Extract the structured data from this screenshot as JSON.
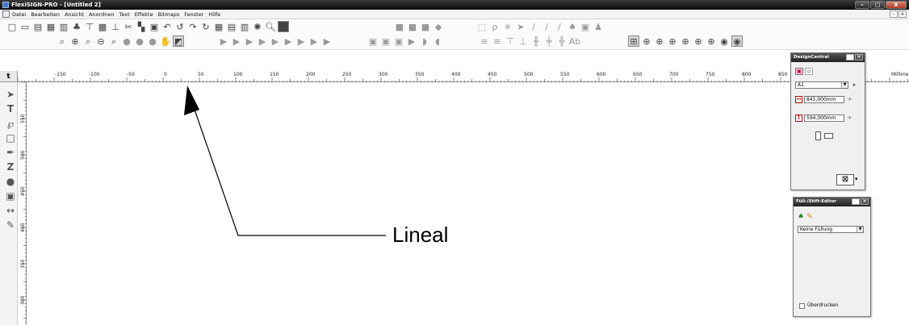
{
  "window": {
    "title": "FlexiSIGN-PRO - [Untitled 2]",
    "controls": [
      "–",
      "□",
      "X"
    ]
  },
  "menubar": {
    "items": [
      "Datei",
      "Bearbeiten",
      "Ansicht",
      "Anordnen",
      "Text",
      "Effekte",
      "Bitmaps",
      "Fenster",
      "Hilfe"
    ],
    "mdi_controls": [
      "–",
      "ė"
    ]
  },
  "ruler": {
    "corner": "t",
    "h_ticks": [
      "-150",
      "-100",
      "-50",
      "0",
      "50",
      "100",
      "150",
      "200",
      "250",
      "300",
      "350",
      "400",
      "450",
      "500",
      "550",
      "600",
      "650",
      "700",
      "750",
      "800",
      "850"
    ],
    "unit": "Millime",
    "v_ticks": [
      "550",
      "500",
      "450",
      "400",
      "350",
      "300"
    ]
  },
  "design_central": {
    "title": "DesignCentral",
    "size_preset": "A1",
    "width": "841,000mm",
    "height": "594,000mm"
  },
  "fill_editor": {
    "title": "Füll-/Stift-Editor",
    "fill_option": "Keine Füllung",
    "overprint_label": "Überdrucken"
  },
  "annotation": {
    "label": "Lineal"
  },
  "colors": {
    "title_bar": "#1a1a1a",
    "close": "#c0472c"
  }
}
